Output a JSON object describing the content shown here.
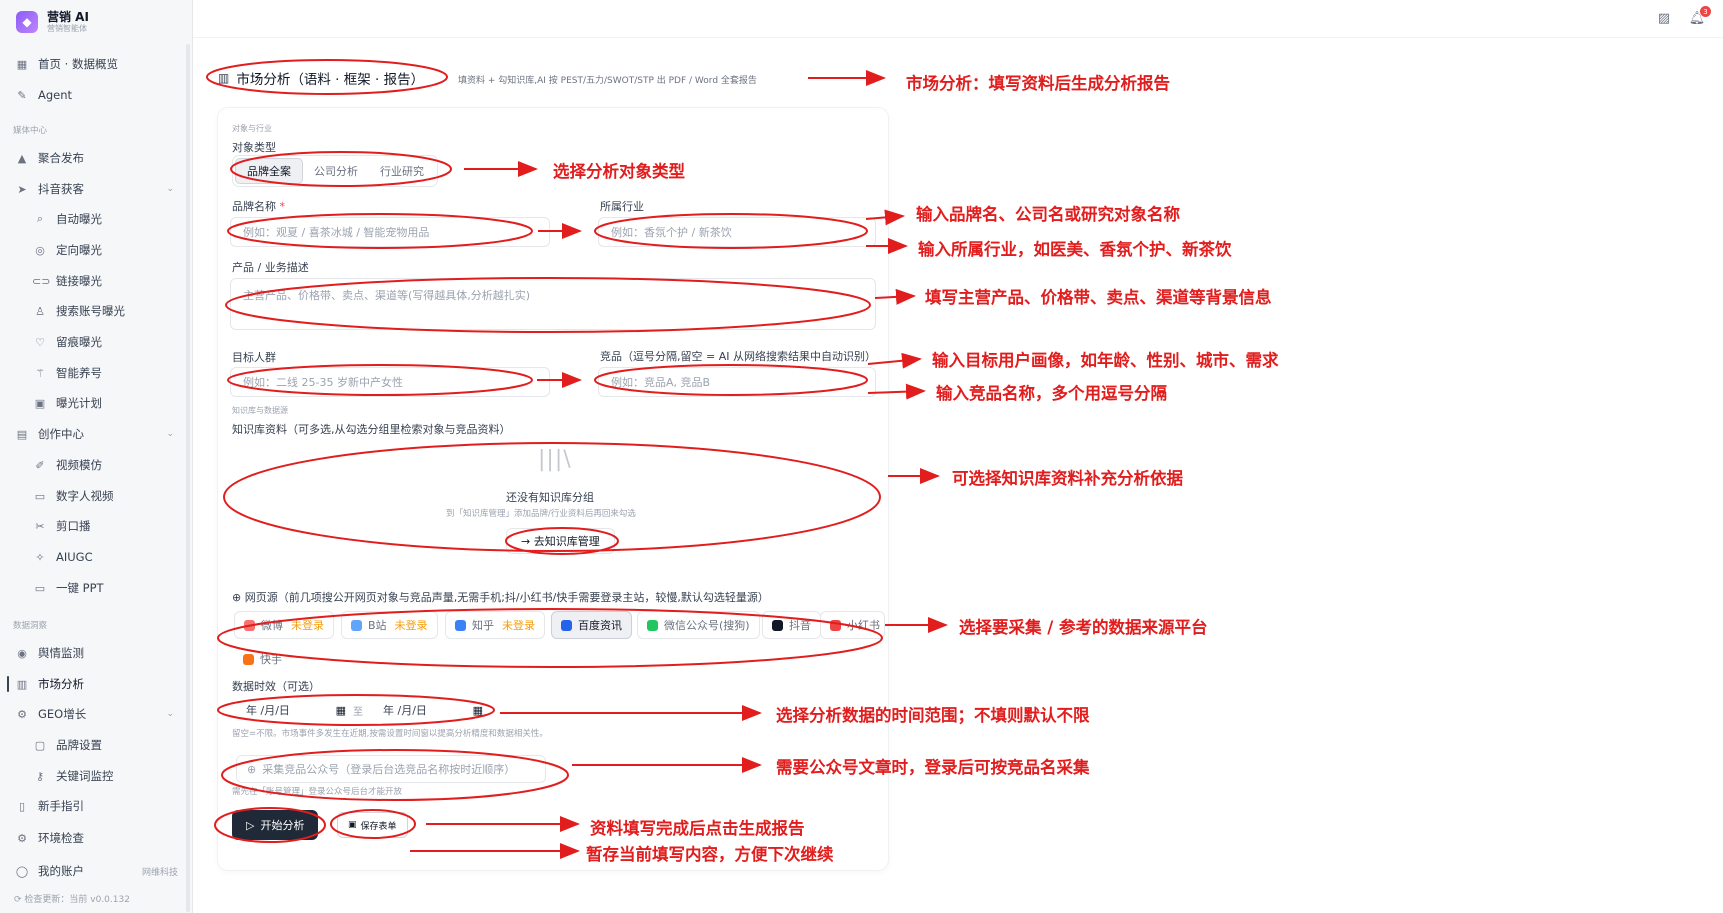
{
  "brand": {
    "title": "营销 AI",
    "subtitle": "营销智能体"
  },
  "sidebar": {
    "top_items": [
      {
        "label": "首页 · 数据概览",
        "icon": "grid-icon"
      },
      {
        "label": "Agent",
        "icon": "agent-icon"
      }
    ],
    "sections": {
      "media": "媒体中心",
      "data": "数据洞察"
    },
    "media_items": [
      {
        "label": "聚合发布",
        "icon": "triangle-icon"
      },
      {
        "label": "抖音获客",
        "icon": "send-icon"
      },
      {
        "label": "自动曝光",
        "icon": "search-icon"
      },
      {
        "label": "定向曝光",
        "icon": "target-icon"
      },
      {
        "label": "链接曝光",
        "icon": "link-icon"
      },
      {
        "label": "搜索账号曝光",
        "icon": "user-search-icon"
      },
      {
        "label": "留痕曝光",
        "icon": "heart-icon"
      },
      {
        "label": "智能养号",
        "icon": "wand-icon"
      },
      {
        "label": "曝光计划",
        "icon": "calendar-icon"
      },
      {
        "label": "创作中心",
        "icon": "palette-icon"
      },
      {
        "label": "视频模仿",
        "icon": "pen-icon"
      },
      {
        "label": "数字人视频",
        "icon": "camera-icon"
      },
      {
        "label": "剪口播",
        "icon": "scissors-icon"
      },
      {
        "label": "AIUGC",
        "icon": "sparkle-icon"
      },
      {
        "label": "一键 PPT",
        "icon": "monitor-icon"
      }
    ],
    "data_items": [
      {
        "label": "舆情监测",
        "icon": "radar-icon"
      },
      {
        "label": "市场分析",
        "icon": "bar-chart-icon"
      },
      {
        "label": "GEO增长",
        "icon": "gear-icon"
      },
      {
        "label": "品牌设置",
        "icon": "box-icon"
      },
      {
        "label": "关键词监控",
        "icon": "key-icon"
      },
      {
        "label": "新手指引",
        "icon": "book-icon"
      },
      {
        "label": "环境检查",
        "icon": "settings-icon"
      }
    ],
    "account": {
      "label": "我的账户",
      "meta": "网维科技"
    },
    "version": "检查更新：当前 v0.0.132"
  },
  "topbar": {
    "notif_count": "3"
  },
  "page": {
    "title": "市场分析（语料 · 框架 · 报告）",
    "desc": "填资料 + 勾知识库,AI 按 PEST/五力/SWOT/STP 出 PDF / Word 全套报告"
  },
  "form": {
    "section_object": "对象与行业",
    "object_type_label": "对象类型",
    "object_types": [
      "品牌全案",
      "公司分析",
      "行业研究"
    ],
    "brand_label": "品牌名称",
    "brand_placeholder": "例如：观夏 / 喜茶冰城 / 智能宠物用品",
    "industry_label": "所属行业",
    "industry_placeholder": "例如：香氛个护 / 新茶饮",
    "product_label": "产品 / 业务描述",
    "product_placeholder": "主营产品、价格带、卖点、渠道等(写得越具体,分析越扎实)",
    "audience_label": "目标人群",
    "audience_placeholder": "例如：二线 25-35 岁新中产女性",
    "competitor_label": "竞品（逗号分隔,留空 = AI 从网络搜索结果中自动识别）",
    "competitor_placeholder": "例如：竞品A, 竞品B",
    "section_kb": "知识库与数据源",
    "kb_label": "知识库资料（可多选,从勾选分组里检索对象与竞品资料）",
    "kb_empty": "还没有知识库分组",
    "kb_hint": "到「知识库管理」添加品牌/行业资料后再回来勾选",
    "kb_button": "→ 去知识库管理",
    "web_label": "⊕ 网页源（前几项搜公开网页对象与竞品声量,无需手机;抖/小红书/快手需要登录主站，较慢,默认勾选轻量源）",
    "sources": [
      {
        "name": "微博",
        "status": "未登录",
        "color": "#f87171"
      },
      {
        "name": "B站",
        "status": "未登录",
        "color": "#60a5fa"
      },
      {
        "name": "知乎",
        "status": "未登录",
        "color": "#3b82f6"
      },
      {
        "name": "百度资讯",
        "status": "",
        "color": "#2563eb"
      },
      {
        "name": "微信公众号(搜狗)",
        "status": "",
        "color": "#22c55e"
      },
      {
        "name": "抖音",
        "status": "",
        "color": "#111827"
      },
      {
        "name": "小红书",
        "status": "",
        "color": "#ef4444"
      },
      {
        "name": "快手",
        "status": "",
        "color": "#f97316"
      }
    ],
    "time_label": "数据时效（可选）",
    "date_placeholder": "年 /月/日",
    "date_sep": "至",
    "time_note": "留空=不限。市场事件多发生在近期,按需设置时间窗以提高分析精度和数据相关性。",
    "wx_placeholder": "采集竞品公众号（登录后台选竞品名称按时近顺序）",
    "wx_note": "需先在「账号管理」登录公众号后台才能开放",
    "start_button": "开始分析",
    "save_button": "保存表单"
  },
  "annotations": {
    "a1": "市场分析：填写资料后生成分析报告",
    "a2": "选择分析对象类型",
    "a3": "输入品牌名、公司名或研究对象名称",
    "a4": "输入所属行业，如医美、香氛个护、新茶饮",
    "a5": "填写主营产品、价格带、卖点、渠道等背景信息",
    "a6": "输入目标用户画像，如年龄、性别、城市、需求",
    "a7": "输入竞品名称，多个用逗号分隔",
    "a8": "可选择知识库资料补充分析依据",
    "a9": "选择要采集 / 参考的数据来源平台",
    "a10": "选择分析数据的时间范围；不填则默认不限",
    "a11": "需要公众号文章时，登录后可按竞品名采集",
    "a12": "资料填写完成后点击生成报告",
    "a13": "暂存当前填写内容，方便下次继续"
  },
  "colors": {
    "annotation": "#e11d1d",
    "primary": "#1f2937",
    "sidebar_bg": "#f6f7f9"
  }
}
